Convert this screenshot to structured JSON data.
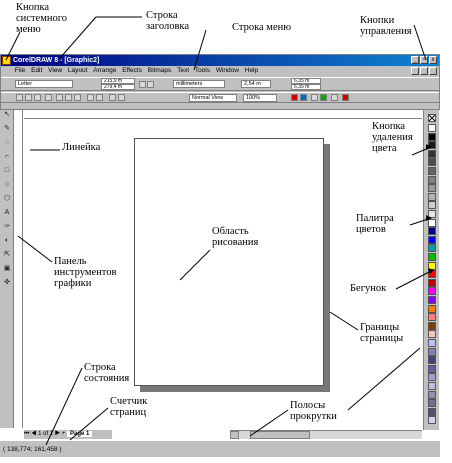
{
  "window": {
    "title": "CorelDRAW 8 - [Graphic2]",
    "controls": [
      "_",
      "▫",
      "x"
    ]
  },
  "menu": [
    "File",
    "Edit",
    "View",
    "Layout",
    "Arrange",
    "Effects",
    "Bitmaps",
    "Text",
    "Tools",
    "Window",
    "Help"
  ],
  "property_bar": {
    "paper": "Letter",
    "width": "215,9 m",
    "height": "279,4 m",
    "units": "millimeters",
    "nudge": "2,54 m",
    "dup_x": "6,35 m",
    "dup_y": "6,35 m"
  },
  "standard_bar": {
    "view_mode": "Normal View",
    "zoom": "100%"
  },
  "toolbox_tools": [
    "↖",
    "✎",
    "◌",
    "⌐",
    "□",
    "○",
    "⬡",
    "A",
    "✑",
    "◐",
    "⇱",
    "▣",
    "✜"
  ],
  "page_nav": {
    "counter": "1 of 1",
    "tab": "Page 1"
  },
  "status": "( 138,774; 161,458 )",
  "annotations": {
    "system_menu_button": "Кнопка системного меню",
    "title_bar": "Строка заголовка",
    "menu_bar": "Строка меню",
    "control_buttons": "Кнопки управления",
    "ruler": "Линейка",
    "delete_color_button": "Кнопка удаления цвета",
    "drawing_area": "Область рисования",
    "color_palette": "Палитра цветов",
    "toolbox": "Панель инструментов графики",
    "slider": "Бегунок",
    "page_borders": "Границы страницы",
    "status_bar": "Строка состояния",
    "page_counter": "Счетчик страниц",
    "scrollbars": "Полосы прокрутки"
  },
  "palette_colors": [
    "#ffffff",
    "#000000",
    "#1a1a1a",
    "#333333",
    "#4d4d4d",
    "#666666",
    "#808080",
    "#999999",
    "#b3b3b3",
    "#cccccc",
    "#e6e6e6",
    "#ffffff",
    "#00008b",
    "#0000ff",
    "#00a0a0",
    "#00c000",
    "#ffff00",
    "#ff0000",
    "#c00000",
    "#ff00ff",
    "#8000ff",
    "#ff8000",
    "#ff8080",
    "#804000",
    "#ffc0c0",
    "#c0c0ff",
    "#8080c0",
    "#404080",
    "#6060a0",
    "#a0a0d0",
    "#c0c0e0",
    "#9090b0",
    "#707090",
    "#505070",
    "#d0d0f0"
  ]
}
